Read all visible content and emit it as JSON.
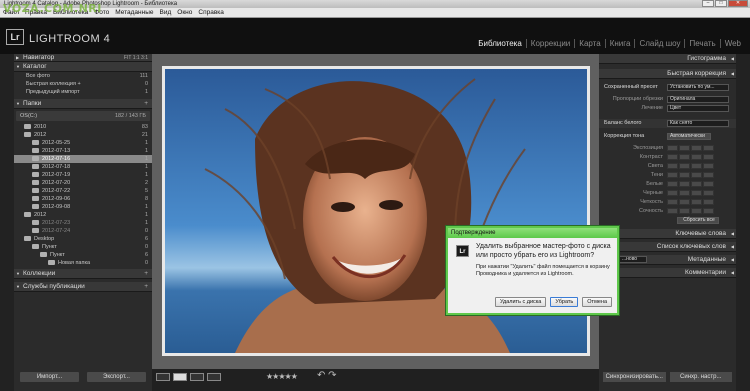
{
  "window": {
    "title": "Lightroom 4 Catalog - Adobe Photoshop Lightroom - Библиотека",
    "watermark": "VOZA.COM.NRI"
  },
  "menu": [
    "Файл",
    "Правка",
    "Библиотека",
    "Фото",
    "Метаданные",
    "Вид",
    "Окно",
    "Справка"
  ],
  "app": {
    "logo": "Lr",
    "name": "LIGHTROOM 4"
  },
  "modules": [
    "Библиотека",
    "Коррекции",
    "Карта",
    "Книга",
    "Слайд шоу",
    "Печать",
    "Web"
  ],
  "left": {
    "navigator": {
      "label": "Навигатор",
      "zoom": "FIT  1:1  3:1"
    },
    "catalog": {
      "label": "Каталог",
      "items": [
        {
          "label": "Все фото",
          "count": "111"
        },
        {
          "label": "Быстрая коллекция +",
          "count": "0"
        },
        {
          "label": "Предыдущий импорт",
          "count": "1"
        }
      ]
    },
    "folders": {
      "label": "Папки",
      "volume": {
        "label": "OS(C:)",
        "count": "182 / 143 ГБ"
      },
      "items": [
        {
          "label": "2010",
          "count": "83",
          "level": 0
        },
        {
          "label": "2012",
          "count": "21",
          "level": 0
        },
        {
          "label": "2012-05-25",
          "count": "1",
          "level": 1
        },
        {
          "label": "2012-07-13",
          "count": "1",
          "level": 1
        },
        {
          "label": "2012-07-16",
          "count": "1",
          "level": 1,
          "selected": true
        },
        {
          "label": "2012-07-18",
          "count": "1",
          "level": 1
        },
        {
          "label": "2012-07-19",
          "count": "1",
          "level": 1
        },
        {
          "label": "2012-07-20",
          "count": "2",
          "level": 1
        },
        {
          "label": "2012-07-22",
          "count": "5",
          "level": 1
        },
        {
          "label": "2012-09-06",
          "count": "8",
          "level": 1
        },
        {
          "label": "2012-09-08",
          "count": "1",
          "level": 1
        },
        {
          "label": "2012",
          "count": "1",
          "level": 0
        },
        {
          "label": "2012-07-23",
          "count": "1",
          "level": 1,
          "dim": true
        },
        {
          "label": "2012-07-24",
          "count": "0",
          "level": 1,
          "dim": true
        },
        {
          "label": "Desktop",
          "count": "6",
          "level": 0
        },
        {
          "label": "Пункт",
          "count": "0",
          "level": 1
        },
        {
          "label": "Пункт",
          "count": "6",
          "level": 2
        },
        {
          "label": "Новая папка",
          "count": "0",
          "level": 3
        }
      ]
    },
    "collections": {
      "label": "Коллекции"
    },
    "publish": {
      "label": "Службы публикации"
    },
    "import_label": "Импорт...",
    "export_label": "Экспорт..."
  },
  "right": {
    "histogram": "Гистограмма",
    "quick_dev": "Быстрая коррекция",
    "saved_preset": {
      "label": "Сохраненный пресет",
      "value": "Установить по ум..."
    },
    "crop": {
      "label": "Пропорции обрезки",
      "value": "Оригинала"
    },
    "treatment": {
      "label": "Лечение",
      "value": "Цвет"
    },
    "wb": {
      "label": "Баланс белого",
      "value": "Как снято"
    },
    "tone": {
      "label": "Коррекция тона",
      "value": "Автоматически"
    },
    "sliders": [
      "Экспозиция",
      "Контраст",
      "Света",
      "Тени",
      "Белые",
      "Черные",
      "Четкость",
      "Сочность"
    ],
    "reset": "Сбросить все",
    "keywords": "Ключевые слова",
    "keyword_list": "Список ключевых слов",
    "metadata": "Метаданные",
    "metadata_preset": "...ново",
    "comments": "Комментарии",
    "sync": "Синхронизировать...",
    "sync_settings": "Синхр. настр..."
  },
  "dialog": {
    "title": "Подтверждение",
    "icon": "Lr",
    "question": "Удалить выбранное мастер-фото с диска или просто убрать его из Lightroom?",
    "note": "При нажатии \"Удалить\" файл помещается в корзину Проводника и удаляется из Lightroom.",
    "btn_delete_disk": "Удалить с диска",
    "btn_remove": "Убрать",
    "btn_cancel": "Отмена"
  },
  "filmstrip": {
    "stars": "★★★★★",
    "rotate": "↶ ↷"
  },
  "colors": {
    "accent_green": "#5cc94a",
    "panel_bg": "#2b2b2b",
    "selected_row": "#8a8a8a"
  }
}
